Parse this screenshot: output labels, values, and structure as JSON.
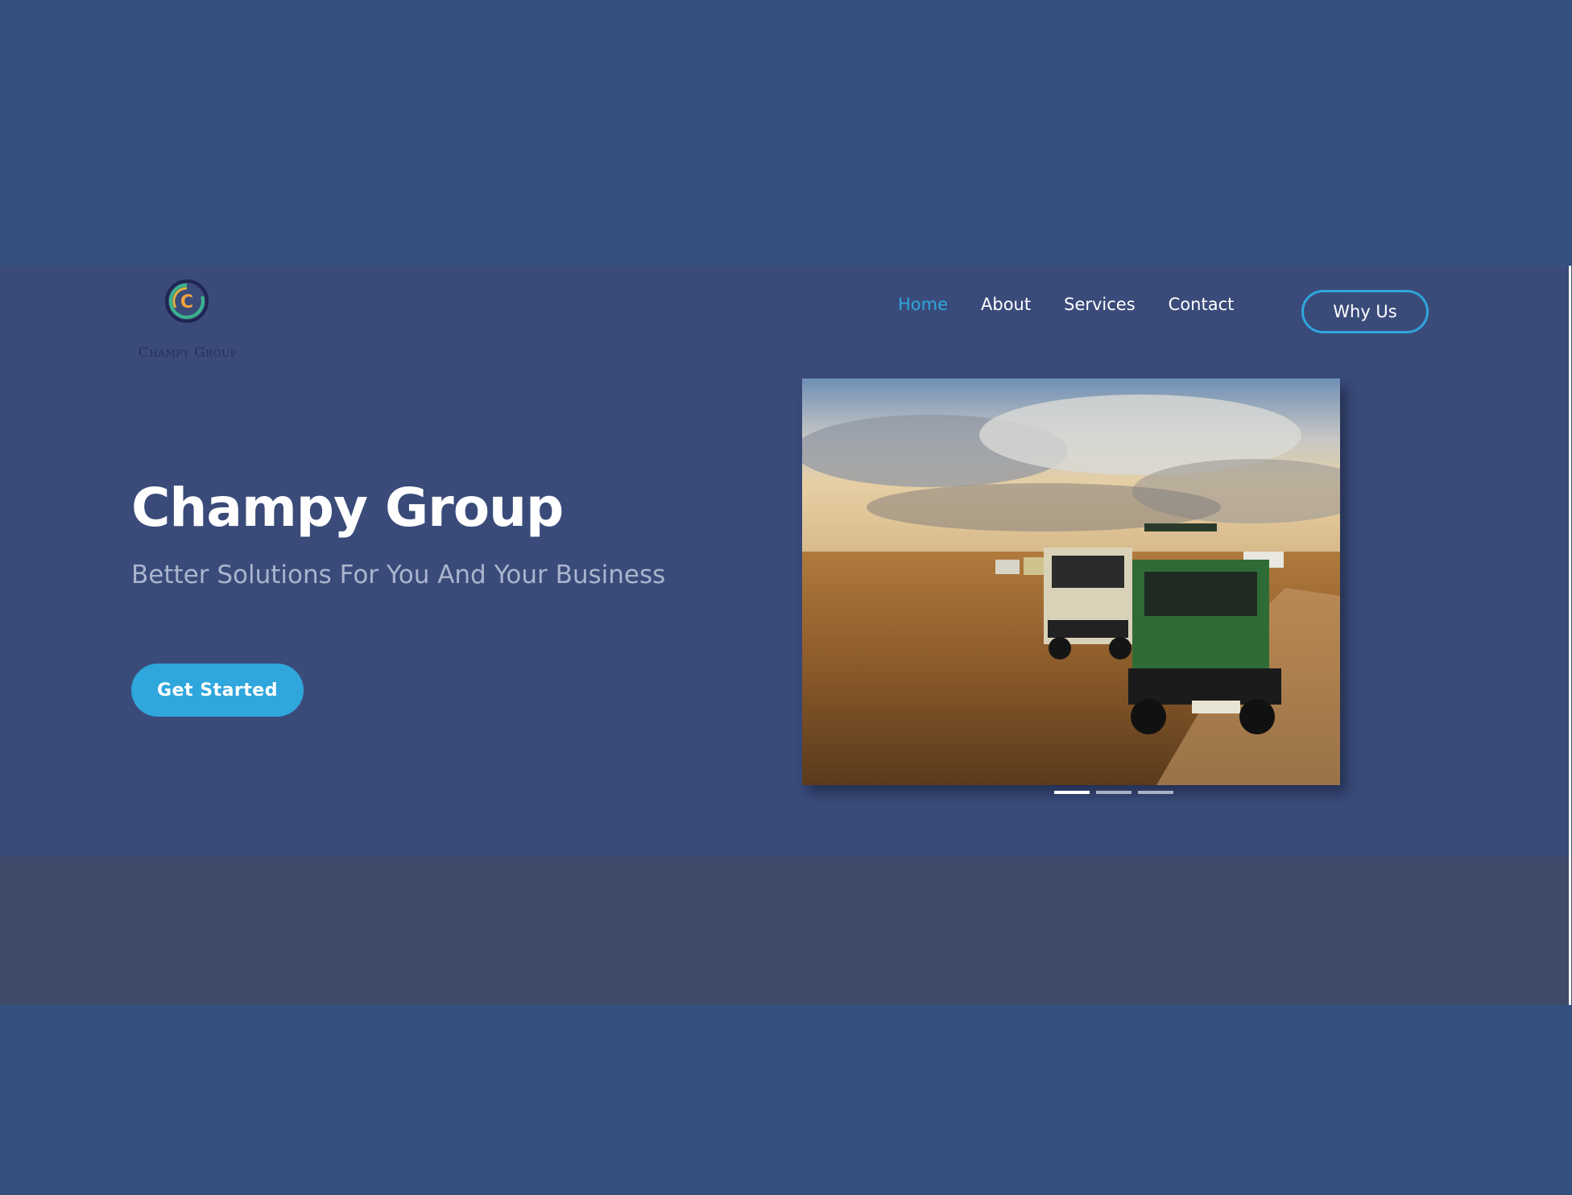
{
  "brand": {
    "name": "Champy Group",
    "logo_text": "Champy Group"
  },
  "nav": {
    "items": [
      {
        "label": "Home",
        "active": true
      },
      {
        "label": "About",
        "active": false
      },
      {
        "label": "Services",
        "active": false
      },
      {
        "label": "Contact",
        "active": false
      }
    ],
    "cta_label": "Why Us"
  },
  "hero": {
    "title": "Champy Group",
    "subtitle": "Better Solutions For You And Your Business",
    "button_label": "Get Started"
  },
  "slider": {
    "image": "safari-vehicles-photo",
    "slide_count": 3,
    "active_index": 0
  },
  "colors": {
    "accent": "#2fa6dc",
    "background": "#34507f",
    "hero": "#3a4b7a"
  }
}
